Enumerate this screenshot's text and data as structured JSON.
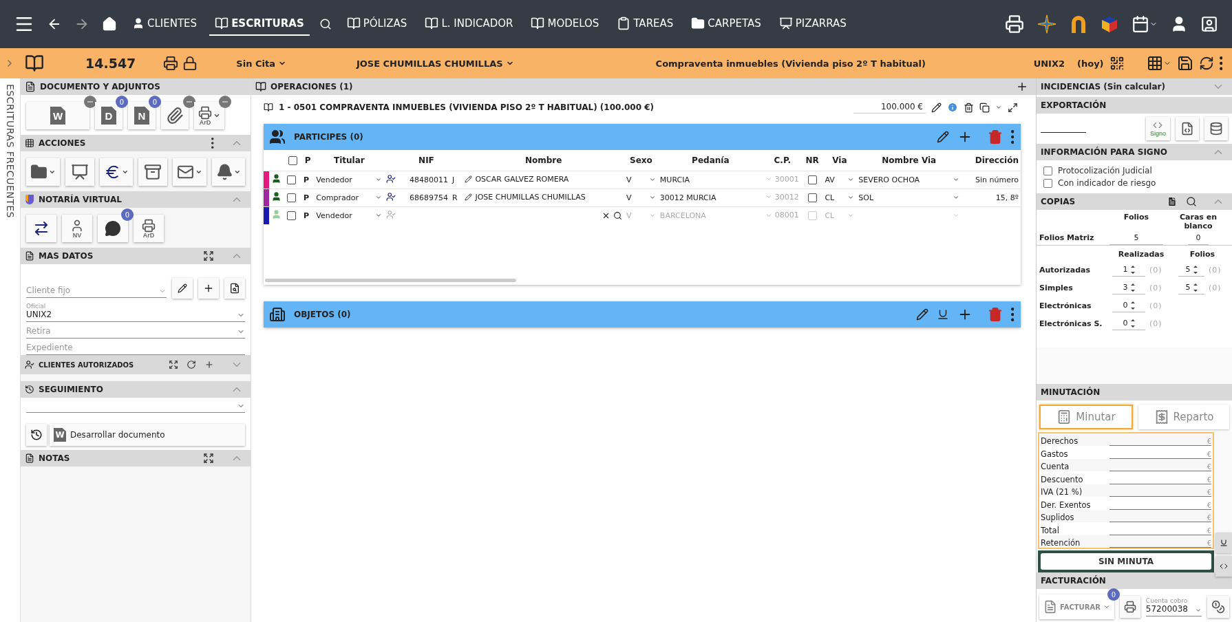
{
  "nav": {
    "items": [
      {
        "kind": "user",
        "label": "CLIENTES",
        "selected": false
      },
      {
        "kind": "deed",
        "label": "ESCRITURAS",
        "selected": true,
        "search": true
      },
      {
        "kind": "deed",
        "label": "PÓLIZAS",
        "selected": false
      },
      {
        "kind": "deed",
        "label": "L. INDICADOR",
        "selected": false
      },
      {
        "kind": "deed",
        "label": "MODELOS",
        "selected": false
      },
      {
        "kind": "clipboard",
        "label": "TAREAS",
        "selected": false
      },
      {
        "kind": "folder",
        "label": "CARPETAS",
        "selected": false
      },
      {
        "kind": "board",
        "label": "PIZARRAS",
        "selected": false
      }
    ]
  },
  "record_bar": {
    "number": "14.547",
    "appointment": "Sin Cita",
    "client": "JOSE CHUMILLAS CHUMILLAS",
    "description": "Compraventa inmuebles (Vivienda piso 2º T habitual)",
    "user": "UNIX2",
    "date": "(hoy)"
  },
  "side_tab": {
    "label": "ESCRITURAS FRECUENTES"
  },
  "documents": {
    "title": "DOCUMENTO Y ADJUNTOS",
    "buttons": [
      {
        "kind": "word",
        "glyph": "W",
        "removable": true
      },
      {
        "kind": "doc",
        "glyph": "D",
        "badge": "0"
      },
      {
        "kind": "doc",
        "glyph": "N",
        "badge": "0"
      },
      {
        "kind": "clip",
        "removable": true
      },
      {
        "kind": "scanner",
        "glyph": "ArD",
        "removable": true,
        "dropdown": true
      }
    ]
  },
  "actions": {
    "title": "ACCIONES",
    "expanded": true,
    "buttons": [
      {
        "kind": "folder",
        "dropdown": true
      },
      {
        "kind": "presenter",
        "dropdown": false
      },
      {
        "kind": "euro",
        "dropdown": true
      },
      {
        "kind": "drawer",
        "dropdown": false
      },
      {
        "kind": "mail",
        "dropdown": true
      },
      {
        "kind": "bell",
        "dropdown": true
      }
    ]
  },
  "virtual_notary": {
    "title": "NOTARÍA VIRTUAL",
    "expanded": true,
    "buttons": [
      {
        "kind": "transfer"
      },
      {
        "kind": "person",
        "glyph": "NV"
      },
      {
        "kind": "chat",
        "badge": "0"
      },
      {
        "kind": "scanner",
        "glyph": "ArD"
      }
    ]
  },
  "more_data": {
    "title": "MAS DATOS",
    "expanded": true,
    "client_field": {
      "placeholder": "Cliente fijo"
    },
    "clerk": {
      "label": "Oficial",
      "value": "UNIX2"
    },
    "collector": {
      "placeholder": "Retira"
    },
    "file": {
      "placeholder": "Expediente"
    }
  },
  "authorized_clients": {
    "title": "CLIENTES AUTORIZADOS",
    "expanded": false
  },
  "follow_up": {
    "title": "SEGUIMIENTO",
    "expanded": true,
    "action": {
      "glyph": "W",
      "label": "Desarrollar documento"
    }
  },
  "notes": {
    "title": "NOTAS",
    "expanded": true
  },
  "operations": {
    "title": "OPERACIONES (1)",
    "operation": {
      "title": "1 - 0501 COMPRAVENTA INMUEBLES (VIVIENDA PISO 2º T HABITUAL) (100.000 €)",
      "amount": "100.000 €"
    }
  },
  "participants": {
    "title": "PARTICIPES (0)",
    "all_checked": false,
    "columns": [
      "P",
      "Titular",
      "NIF",
      "Nombre",
      "Sexo",
      "Pedanía",
      "C.P.",
      "NR",
      "Via",
      "Nombre Via",
      "Dirección"
    ],
    "rows": [
      {
        "color": "#e6197f",
        "disabled": false,
        "checked": false,
        "p": "P",
        "role": "Vendedor",
        "nif": "48480011",
        "letter": "J",
        "name": "OSCAR GALVEZ ROMERA",
        "sex": "V",
        "district": "MURCIA",
        "zip": "30001",
        "nr": false,
        "via": "AV",
        "street": "SEVERO OCHOA",
        "address": "Sin número"
      },
      {
        "color": "#a0289e",
        "disabled": false,
        "checked": false,
        "p": "P",
        "role": "Comprador",
        "nif": "68689754",
        "letter": "R",
        "name": "JOSE CHUMILLAS CHUMILLAS",
        "sex": "V",
        "district": "30012 MURCIA",
        "zip": "30012",
        "nr": false,
        "via": "CL",
        "street": "SOL",
        "address": "15, 8º"
      },
      {
        "color": "#1b1bb0",
        "disabled": true,
        "checked": false,
        "p": "P",
        "role": "Vendedor",
        "sex": "V",
        "district": "BARCELONA",
        "zip": "08001",
        "nr": false,
        "via": "CL"
      }
    ]
  },
  "objects": {
    "title": "OBJETOS (0)"
  },
  "incidents": {
    "title": "INCIDENCIAS (Sin calcular)",
    "expanded": false
  },
  "export": {
    "title": "EXPORTACIÓN",
    "signo_glyph": "Signo"
  },
  "signo_info": {
    "title": "INFORMACIÓN PARA SIGNO",
    "expanded": true,
    "options": [
      {
        "label": "Protocolización Judicial",
        "checked": false
      },
      {
        "label": "Con indicador de riesgo",
        "checked": false
      }
    ]
  },
  "copies": {
    "title": "COPIAS",
    "expanded": true,
    "matrix_headers": [
      "Folios",
      "Caras en blanco"
    ],
    "matrix": {
      "label": "Folios Matriz",
      "values": [
        "5",
        "0"
      ]
    },
    "headers": [
      "Realizadas",
      "Folios"
    ],
    "rows": [
      {
        "label": "Autorizadas",
        "done": "1",
        "done_pending": "(0)",
        "folios": "5",
        "folios_pending": "(0)"
      },
      {
        "label": "Simples",
        "done": "3",
        "done_pending": "(0)",
        "folios": "5",
        "folios_pending": "(0)"
      },
      {
        "label": "Electrónicas",
        "done": "0",
        "done_pending": "(0)"
      },
      {
        "label": "Electrónicas S.",
        "done": "0",
        "done_pending": "(0)"
      }
    ]
  },
  "billing_calc": {
    "title": "MINUTACIÓN",
    "buttons": [
      {
        "kind": "calculator",
        "label": "Minutar",
        "selected": true
      },
      {
        "kind": "split",
        "label": "Reparto",
        "selected": false
      }
    ],
    "rows": [
      {
        "label": "Derechos",
        "currency": "€"
      },
      {
        "label": "Gastos",
        "currency": "€"
      },
      {
        "label": "Cuenta",
        "currency": "€"
      },
      {
        "label": "Descuento",
        "currency": "€"
      },
      {
        "label": "IVA (21 %)",
        "currency": "€"
      },
      {
        "label": "Der. Exentos",
        "currency": "€"
      },
      {
        "label": "Suplidos",
        "currency": "€"
      },
      {
        "label": "Total",
        "currency": "€"
      },
      {
        "label": "Retención",
        "currency": "€"
      }
    ],
    "status": "SIN MINUTA"
  },
  "invoicing": {
    "title": "FACTURACIÓN",
    "invoice": {
      "label": "FACTURAR",
      "badge": "0"
    },
    "account": {
      "label": "Cuenta cobro",
      "value": "57200038"
    }
  }
}
